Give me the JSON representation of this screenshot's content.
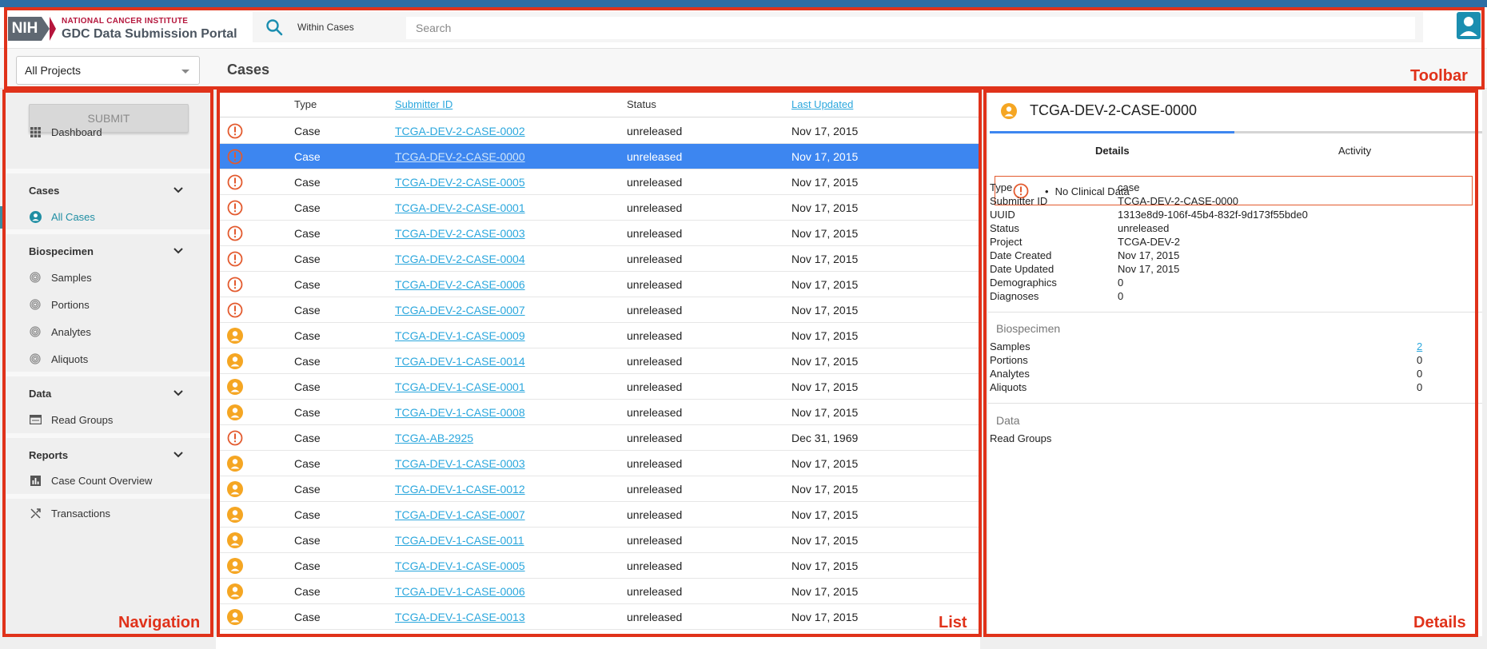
{
  "header": {
    "logo_badge": "NIH",
    "logo_org": "NATIONAL CANCER INSTITUTE",
    "logo_product": "GDC Data Submission Portal",
    "search_scope": "Within Cases",
    "search_placeholder": "Search"
  },
  "subheader": {
    "project_select": "All Projects",
    "page_title": "Cases"
  },
  "sidebar": {
    "submit_label": "SUBMIT",
    "dashboard": "Dashboard",
    "cases_heading": "Cases",
    "all_cases": "All Cases",
    "biospecimen_heading": "Biospecimen",
    "samples": "Samples",
    "portions": "Portions",
    "analytes": "Analytes",
    "aliquots": "Aliquots",
    "data_heading": "Data",
    "read_groups": "Read Groups",
    "reports_heading": "Reports",
    "case_count_overview": "Case Count Overview",
    "transactions": "Transactions"
  },
  "list": {
    "headers": {
      "type": "Type",
      "submitter_id": "Submitter ID",
      "status": "Status",
      "last_updated": "Last Updated"
    },
    "rows": [
      {
        "icon": "warning",
        "type": "Case",
        "submitter_id": "TCGA-DEV-2-CASE-0002",
        "status": "unreleased",
        "updated": "Nov 17, 2015"
      },
      {
        "icon": "warning",
        "type": "Case",
        "submitter_id": "TCGA-DEV-2-CASE-0000",
        "status": "unreleased",
        "updated": "Nov 17, 2015",
        "selected": true
      },
      {
        "icon": "warning",
        "type": "Case",
        "submitter_id": "TCGA-DEV-2-CASE-0005",
        "status": "unreleased",
        "updated": "Nov 17, 2015"
      },
      {
        "icon": "warning",
        "type": "Case",
        "submitter_id": "TCGA-DEV-2-CASE-0001",
        "status": "unreleased",
        "updated": "Nov 17, 2015"
      },
      {
        "icon": "warning",
        "type": "Case",
        "submitter_id": "TCGA-DEV-2-CASE-0003",
        "status": "unreleased",
        "updated": "Nov 17, 2015"
      },
      {
        "icon": "warning",
        "type": "Case",
        "submitter_id": "TCGA-DEV-2-CASE-0004",
        "status": "unreleased",
        "updated": "Nov 17, 2015"
      },
      {
        "icon": "warning",
        "type": "Case",
        "submitter_id": "TCGA-DEV-2-CASE-0006",
        "status": "unreleased",
        "updated": "Nov 17, 2015"
      },
      {
        "icon": "warning",
        "type": "Case",
        "submitter_id": "TCGA-DEV-2-CASE-0007",
        "status": "unreleased",
        "updated": "Nov 17, 2015"
      },
      {
        "icon": "person",
        "type": "Case",
        "submitter_id": "TCGA-DEV-1-CASE-0009",
        "status": "unreleased",
        "updated": "Nov 17, 2015"
      },
      {
        "icon": "person",
        "type": "Case",
        "submitter_id": "TCGA-DEV-1-CASE-0014",
        "status": "unreleased",
        "updated": "Nov 17, 2015"
      },
      {
        "icon": "person",
        "type": "Case",
        "submitter_id": "TCGA-DEV-1-CASE-0001",
        "status": "unreleased",
        "updated": "Nov 17, 2015"
      },
      {
        "icon": "person",
        "type": "Case",
        "submitter_id": "TCGA-DEV-1-CASE-0008",
        "status": "unreleased",
        "updated": "Nov 17, 2015"
      },
      {
        "icon": "warning",
        "type": "Case",
        "submitter_id": "TCGA-AB-2925",
        "status": "unreleased",
        "updated": "Dec 31, 1969"
      },
      {
        "icon": "person",
        "type": "Case",
        "submitter_id": "TCGA-DEV-1-CASE-0003",
        "status": "unreleased",
        "updated": "Nov 17, 2015"
      },
      {
        "icon": "person",
        "type": "Case",
        "submitter_id": "TCGA-DEV-1-CASE-0012",
        "status": "unreleased",
        "updated": "Nov 17, 2015"
      },
      {
        "icon": "person",
        "type": "Case",
        "submitter_id": "TCGA-DEV-1-CASE-0007",
        "status": "unreleased",
        "updated": "Nov 17, 2015"
      },
      {
        "icon": "person",
        "type": "Case",
        "submitter_id": "TCGA-DEV-1-CASE-0011",
        "status": "unreleased",
        "updated": "Nov 17, 2015"
      },
      {
        "icon": "person",
        "type": "Case",
        "submitter_id": "TCGA-DEV-1-CASE-0005",
        "status": "unreleased",
        "updated": "Nov 17, 2015"
      },
      {
        "icon": "person",
        "type": "Case",
        "submitter_id": "TCGA-DEV-1-CASE-0006",
        "status": "unreleased",
        "updated": "Nov 17, 2015"
      },
      {
        "icon": "person",
        "type": "Case",
        "submitter_id": "TCGA-DEV-1-CASE-0013",
        "status": "unreleased",
        "updated": "Nov 17, 2015"
      }
    ]
  },
  "details": {
    "title": "TCGA-DEV-2-CASE-0000",
    "tab_details": "Details",
    "tab_activity": "Activity",
    "alert": "No Clinical Data",
    "props": [
      {
        "k": "Type",
        "v": "case"
      },
      {
        "k": "Submitter ID",
        "v": "TCGA-DEV-2-CASE-0000"
      },
      {
        "k": "UUID",
        "v": "1313e8d9-106f-45b4-832f-9d173f55bde0"
      },
      {
        "k": "Status",
        "v": "unreleased"
      },
      {
        "k": "Project",
        "v": "TCGA-DEV-2"
      },
      {
        "k": "Date Created",
        "v": "Nov 17, 2015"
      },
      {
        "k": "Date Updated",
        "v": "Nov 17, 2015"
      },
      {
        "k": "Demographics",
        "v": "0"
      },
      {
        "k": "Diagnoses",
        "v": "0"
      }
    ],
    "biospecimen_title": "Biospecimen",
    "biospecimen": [
      {
        "k": "Samples",
        "v": "2",
        "link": true
      },
      {
        "k": "Portions",
        "v": "0"
      },
      {
        "k": "Analytes",
        "v": "0"
      },
      {
        "k": "Aliquots",
        "v": "0"
      }
    ],
    "data_title": "Data",
    "data_items": [
      {
        "k": "Read Groups"
      }
    ]
  },
  "annotations": {
    "toolbar": "Toolbar",
    "navigation": "Navigation",
    "list": "List",
    "details": "Details"
  },
  "colors": {
    "accent_blue": "#3d86f0",
    "link_blue": "#2ba7dd",
    "warning_red": "#e35a2e",
    "person_orange": "#f5a623",
    "annotation_red": "#e0321a"
  }
}
